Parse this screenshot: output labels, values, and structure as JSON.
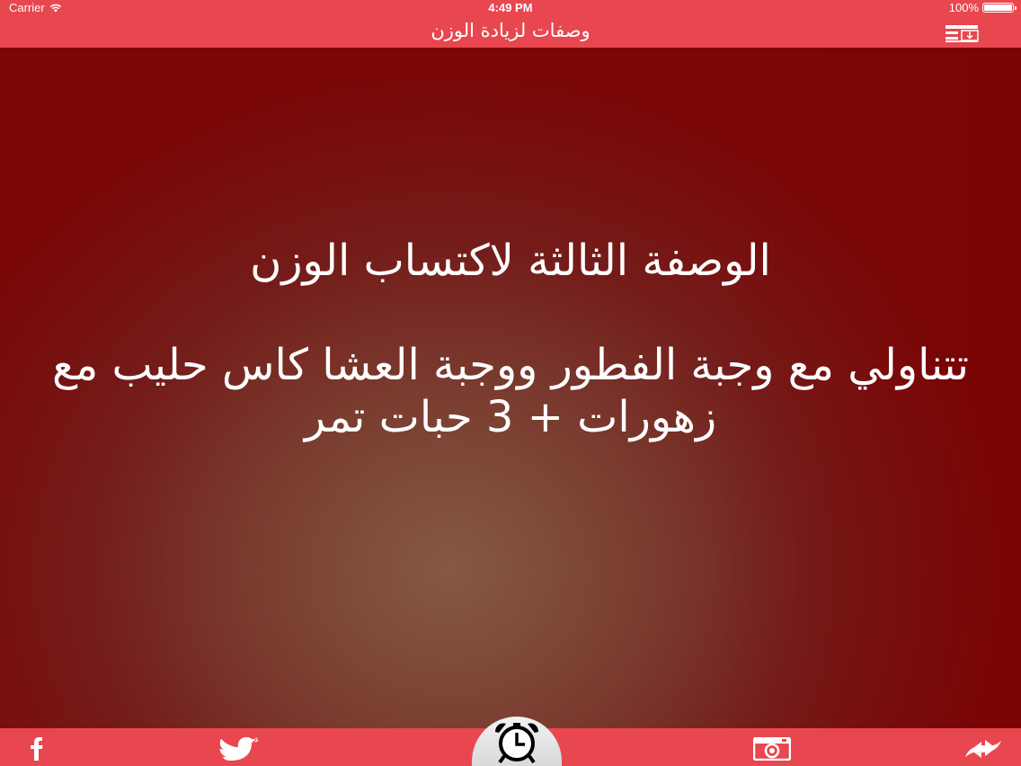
{
  "status_bar": {
    "carrier": "Carrier",
    "time": "4:49 PM",
    "battery": "100%"
  },
  "nav": {
    "title": "وصفات لزيادة الوزن",
    "right_icon": "download-list-icon"
  },
  "recipe": {
    "title": "الوصفة الثالثة لاكتساب الوزن",
    "body": "تتناولي مع وجبة الفطور ووجبة العشا كاس حليب مع زهورات + 3 حبات تمر"
  },
  "tab_bar": {
    "items": [
      {
        "icon": "facebook-icon"
      },
      {
        "icon": "twitter-icon"
      },
      {
        "icon": "alarm-clock-icon"
      },
      {
        "icon": "instagram-icon"
      },
      {
        "icon": "share-icon"
      }
    ]
  },
  "colors": {
    "bar": "#e8474f",
    "background_dark": "#7a0606",
    "background_center": "#855a44"
  }
}
